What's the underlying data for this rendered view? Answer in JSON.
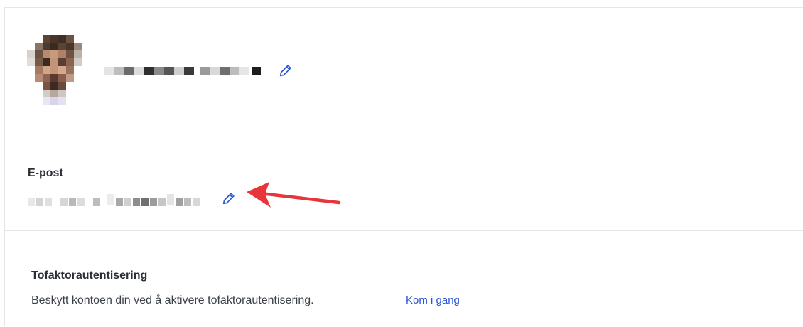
{
  "profile": {
    "avatar_alt": "",
    "edit_icon": "pencil-icon"
  },
  "email": {
    "label": "E-post",
    "edit_icon": "pencil-icon"
  },
  "two_factor": {
    "label": "Tofaktorautentisering",
    "description": "Beskytt kontoen din ved å aktivere tofaktorautentisering.",
    "link": "Kom i gang"
  },
  "colors": {
    "accent": "#2a55d6",
    "annotation_arrow": "#e8353b",
    "border": "#e6e6e6"
  }
}
